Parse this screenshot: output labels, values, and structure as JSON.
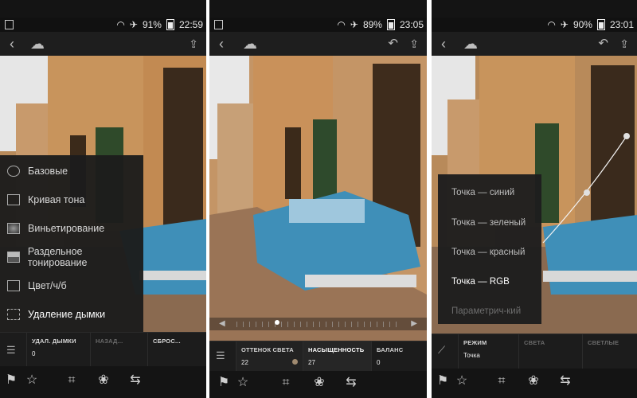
{
  "phone1": {
    "status": {
      "battery": "91%",
      "time": "22:59"
    },
    "menu": [
      {
        "label": "Базовые",
        "icon": "aperture-icon"
      },
      {
        "label": "Кривая тона",
        "icon": "tone-curve-icon"
      },
      {
        "label": "Виньетирование",
        "icon": "vignette-icon"
      },
      {
        "label": "Раздельное тонирование",
        "icon": "split-tone-icon"
      },
      {
        "label": "Цвет/ч/б",
        "icon": "color-bw-icon"
      },
      {
        "label": "Удаление дымки",
        "icon": "dehaze-icon"
      }
    ],
    "panel": {
      "col1": {
        "label": "УДАЛ. ДЫМКИ",
        "value": "0"
      },
      "col2": {
        "label": "НАЗАД..."
      },
      "col3": {
        "label": "СБРОС..."
      }
    }
  },
  "phone2": {
    "status": {
      "battery": "89%",
      "time": "23:05"
    },
    "slider": {
      "value_fraction": 0.25
    },
    "panel": {
      "col1": {
        "label": "ОТТЕНОК СВЕТА",
        "value": "22"
      },
      "col2": {
        "label": "НАСЫЩЕННОСТЬ",
        "value": "27"
      },
      "col3": {
        "label": "БАЛАНС",
        "value": "0"
      }
    }
  },
  "phone3": {
    "status": {
      "battery": "90%",
      "time": "23:01"
    },
    "menu": [
      {
        "label": "Точка — синий"
      },
      {
        "label": "Точка — зеленый"
      },
      {
        "label": "Точка — красный"
      },
      {
        "label": "Точка — RGB"
      },
      {
        "label": "Параметрич-кий"
      }
    ],
    "panel": {
      "col1": {
        "label": "РЕЖИМ",
        "value": "Точка"
      },
      "col2": {
        "label": "СВЕТА"
      },
      "col3": {
        "label": "СВЕТЛЫЕ"
      }
    }
  }
}
